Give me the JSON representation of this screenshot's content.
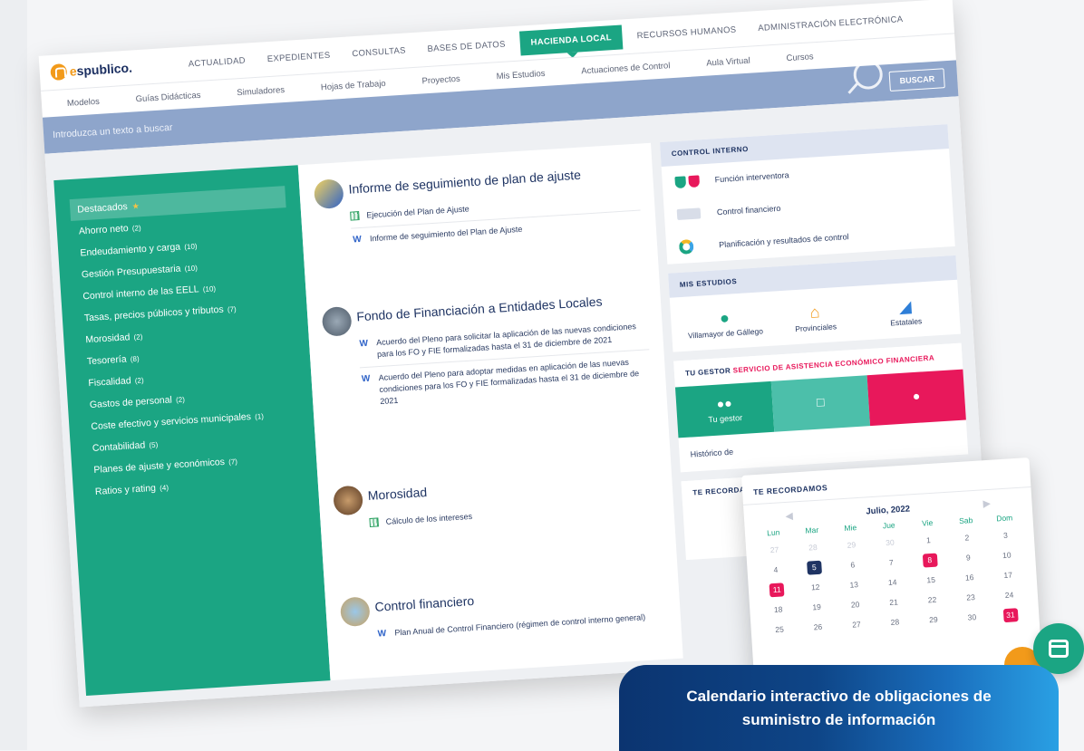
{
  "brand": {
    "prefix": "e",
    "name": "spublico."
  },
  "main_tabs": [
    "ACTUALIDAD",
    "EXPEDIENTES",
    "CONSULTAS",
    "BASES DE DATOS",
    "HACIENDA LOCAL",
    "RECURSOS HUMANOS",
    "ADMINISTRACIÓN ELECTRÓNICA"
  ],
  "active_tab_index": 4,
  "sub_tabs": [
    "Modelos",
    "Guías Didácticas",
    "Simuladores",
    "Hojas de Trabajo",
    "Proyectos",
    "Mis Estudios",
    "Actuaciones de Control",
    "Aula Virtual",
    "Cursos"
  ],
  "search": {
    "placeholder": "Introduzca un texto a buscar",
    "button": "BUSCAR"
  },
  "sidebar": {
    "items": [
      {
        "label": "Destacados",
        "count": "",
        "selected": true,
        "star": "★"
      },
      {
        "label": "Ahorro neto",
        "count": "(2)"
      },
      {
        "label": "Endeudamiento y carga",
        "count": "(10)"
      },
      {
        "label": "Gestión Presupuestaria",
        "count": "(10)"
      },
      {
        "label": "Control interno de las EELL",
        "count": "(10)"
      },
      {
        "label": "Tasas, precios públicos y tributos",
        "count": "(7)"
      },
      {
        "label": "Morosidad",
        "count": "(2)"
      },
      {
        "label": "Tesorería",
        "count": "(8)"
      },
      {
        "label": "Fiscalidad",
        "count": "(2)"
      },
      {
        "label": "Gastos de personal",
        "count": "(2)"
      },
      {
        "label": "Coste efectivo y servicios municipales",
        "count": "(1)"
      },
      {
        "label": "Contabilidad",
        "count": "(5)"
      },
      {
        "label": "Planes de ajuste y económicos",
        "count": "(7)"
      },
      {
        "label": "Ratios y rating",
        "count": "(4)"
      }
    ]
  },
  "articles": [
    {
      "title": "Informe de seguimiento de plan de ajuste",
      "docs": [
        {
          "icon": "x",
          "text": "Ejecución del Plan de Ajuste"
        },
        {
          "icon": "W",
          "text": "Informe de seguimiento del Plan de Ajuste"
        }
      ]
    },
    {
      "title": "Fondo de Financiación a Entidades Locales",
      "docs": [
        {
          "icon": "W",
          "text": "Acuerdo del Pleno para solicitar la aplicación de las nuevas condiciones para los FO y FIE formalizadas hasta el 31 de diciembre de 2021"
        },
        {
          "icon": "W",
          "text": "Acuerdo del Pleno para adoptar medidas en aplicación de las nuevas condiciones para los FO y FIE formalizadas hasta el 31 de diciembre de 2021"
        }
      ]
    },
    {
      "title": "Morosidad",
      "docs": [
        {
          "icon": "x",
          "text": "Cálculo de los intereses"
        }
      ]
    },
    {
      "title": "Control financiero",
      "docs": [
        {
          "icon": "W",
          "text": "Plan Anual de Control Financiero (régimen de control interno general)"
        }
      ]
    }
  ],
  "control_interno": {
    "header": "CONTROL INTERNO",
    "items": [
      "Función interventora",
      "Control financiero",
      "Planificación y resultados de control"
    ]
  },
  "mis_estudios": {
    "header": "MIS ESTUDIOS",
    "items": [
      {
        "label": "Villamayor de Gállego",
        "icon": "map-pin-icon",
        "color": "#1ba583"
      },
      {
        "label": "Provinciales",
        "icon": "building-icon",
        "color": "#f29a1a"
      },
      {
        "label": "Estatales",
        "icon": "spain-map-icon",
        "color": "#2f7fd8"
      }
    ]
  },
  "gestor": {
    "prefix": "TU GESTOR",
    "highlight": "SERVICIO DE ASISTENCIA ECONÓMICO FINANCIERA",
    "tile_label": "Tu gestor",
    "historic": "Histórico de"
  },
  "recordamos_header": "TE RECORDAMOS",
  "calendar": {
    "title": "TE RECORDAMOS",
    "month": "Julio, 2022",
    "weekdays": [
      "Lun",
      "Mar",
      "Mie",
      "Jue",
      "Vie",
      "Sab",
      "Dom"
    ],
    "weeks": [
      [
        "27",
        "28",
        "29",
        "30",
        "1",
        "2",
        "3"
      ],
      [
        "4",
        "5",
        "6",
        "7",
        "8",
        "9",
        "10"
      ],
      [
        "11",
        "12",
        "13",
        "14",
        "15",
        "16",
        "17"
      ],
      [
        "18",
        "19",
        "20",
        "21",
        "22",
        "23",
        "24"
      ],
      [
        "25",
        "26",
        "27",
        "28",
        "29",
        "30",
        "31"
      ]
    ],
    "outside": [
      "0-0",
      "0-1",
      "0-2",
      "0-3"
    ],
    "highlight_blue": [
      "1-1"
    ],
    "highlight_pink": [
      "1-4",
      "2-0",
      "4-6"
    ]
  },
  "colors": {
    "green": "#1ba583",
    "navy": "#1f3463",
    "pink": "#e8185b",
    "orange": "#f29a1a"
  },
  "banner": "Calendario interactivo de obligaciones de suministro de información"
}
